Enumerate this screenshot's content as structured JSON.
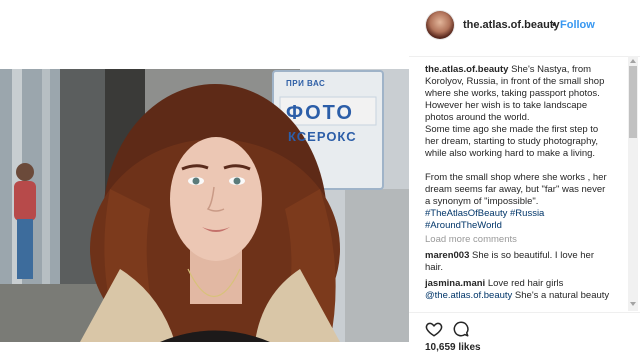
{
  "header": {
    "username": "the.atlas.of.beauty",
    "separator": "•",
    "follow_label": "Follow"
  },
  "photo": {
    "sign_top": "ПРИ ВАС",
    "sign_main": "ФОТО",
    "sign_bottom": "КСЕРОКС"
  },
  "caption": {
    "username": "the.atlas.of.beauty",
    "lines": [
      "She's Nastya, from",
      "Korolyov, Russia, in front of the small shop",
      "where she works, taking passport photos.",
      "However her wish is to take landscape",
      "photos around the world.",
      "Some time ago she made the first step to",
      "her dream, starting to study photography,",
      "while also working hard to make a living."
    ],
    "lines2": [
      "From the small shop where she works , her",
      "dream seems far away, but \"far\" was never",
      "a synonym of \"impossible\"."
    ],
    "hashtags_line1": "#TheAtlasOfBeauty #Russia",
    "hashtags_line2": "#AroundTheWorld"
  },
  "load_more": "Load more comments",
  "comments": [
    {
      "user": "maren003",
      "text": "She is so beautiful. I love her",
      "text2": "hair."
    },
    {
      "user": "jasmina.mani",
      "text": "Love red hair girls",
      "mention": "@the.atlas.of.beauty",
      "text2": "She's a natural beauty"
    }
  ],
  "likes": "10,659 likes",
  "icons": {
    "like": "heart-icon",
    "comment": "comment-icon"
  },
  "colors": {
    "link": "#3897f0",
    "hashtag": "#003569",
    "muted": "#999999",
    "text": "#262626"
  }
}
